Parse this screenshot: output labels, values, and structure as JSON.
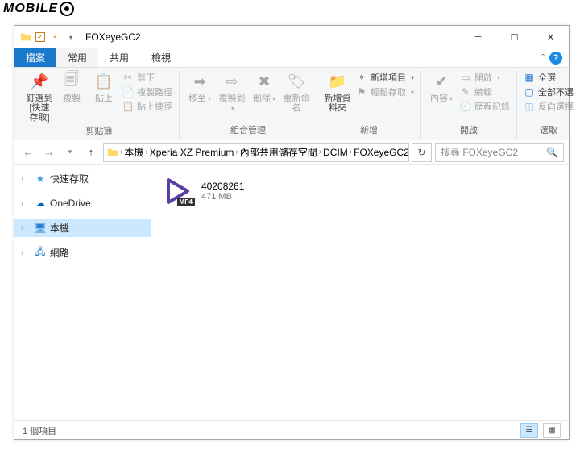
{
  "watermark": "MOBILE",
  "title": "FOXeyeGC2",
  "tabs": {
    "file": "檔案",
    "home": "常用",
    "share": "共用",
    "view": "檢視"
  },
  "ribbon": {
    "pin": "釘選到 [快速存取]",
    "copy": "複製",
    "paste": "貼上",
    "cut": "剪下",
    "copy_path": "複製路徑",
    "paste_shortcut": "貼上捷徑",
    "group_clipboard": "剪貼簿",
    "move_to": "移至",
    "copy_to": "複製到",
    "delete": "刪除",
    "rename": "重新命名",
    "group_organize": "組合管理",
    "new_folder": "新增資料夾",
    "new_item": "新增項目",
    "easy_access": "輕鬆存取",
    "group_new": "新增",
    "properties": "內容",
    "open": "開啟",
    "edit": "編輯",
    "history": "歷程記錄",
    "group_open": "開啟",
    "select_all": "全選",
    "select_none": "全部不選",
    "invert": "反向選擇",
    "group_select": "選取"
  },
  "breadcrumb": [
    "本機",
    "Xperia XZ Premium",
    "內部共用儲存空間",
    "DCIM",
    "FOXeyeGC2"
  ],
  "search_placeholder": "搜尋 FOXeyeGC2",
  "sidebar": {
    "quick": "快速存取",
    "onedrive": "OneDrive",
    "thispc": "本機",
    "network": "網路"
  },
  "file": {
    "name": "40208261",
    "size": "471 MB",
    "badge": "MP4"
  },
  "status": "1 個項目"
}
